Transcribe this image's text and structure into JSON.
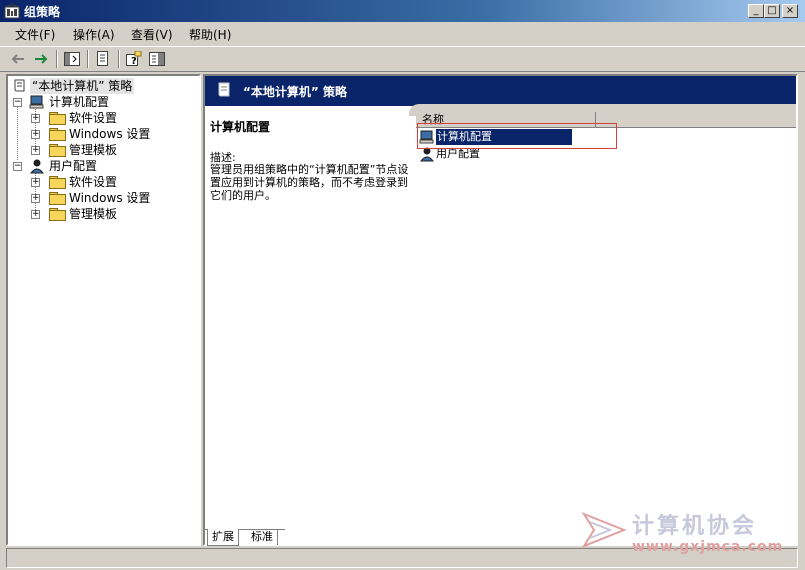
{
  "window": {
    "title": "组策略",
    "controls": [
      "_",
      "□",
      "×"
    ]
  },
  "menubar": {
    "items": [
      "文件(F)",
      "操作(A)",
      "查看(V)",
      "帮助(H)"
    ]
  },
  "toolbar": {
    "icons": [
      "back-arrow-icon",
      "forward-arrow-icon",
      "show-tree-icon",
      "export-list-icon",
      "help-icon",
      "console-icon"
    ]
  },
  "tree": {
    "root": "“本地计算机” 策略",
    "computer": "计算机配置",
    "computer_children": [
      "软件设置",
      "Windows 设置",
      "管理模板"
    ],
    "user": "用户配置",
    "user_children": [
      "软件设置",
      "Windows 设置",
      "管理模板"
    ]
  },
  "right": {
    "banner_title": "“本地计算机” 策略",
    "desc_title": "计算机配置",
    "desc_label": "描述:",
    "desc_body": "管理员用组策略中的“计算机配置”节点设置应用到计算机的策略，而不考虑登录到它们的用户。",
    "column_header": "名称",
    "list": [
      "计算机配置",
      "用户配置"
    ]
  },
  "bottom_tabs": [
    "扩展",
    "标准"
  ],
  "watermark": {
    "text": "计算机协会",
    "url": "www.gxjmca.com"
  },
  "colors": {
    "title_bar": "#0a246a",
    "selection": "#0a246a",
    "highlight_box": "#d84040"
  }
}
